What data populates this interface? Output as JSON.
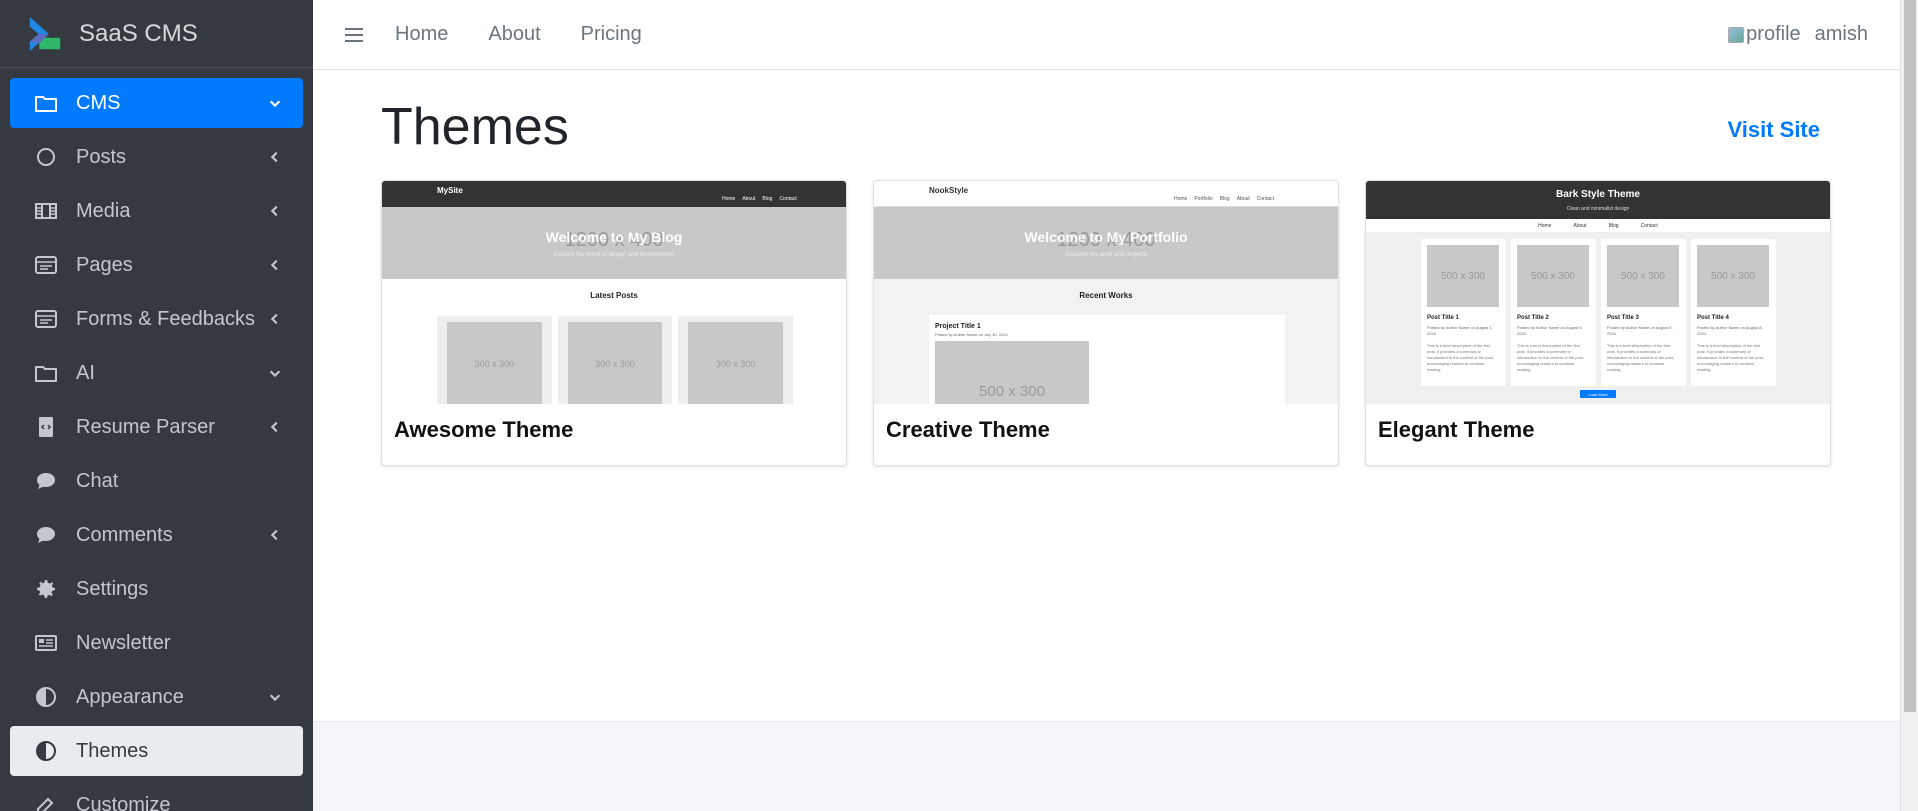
{
  "brand": {
    "name": "SaaS CMS"
  },
  "sidebar": {
    "items": [
      {
        "label": "CMS",
        "icon": "folder-icon",
        "arrow": "down",
        "state": "active"
      },
      {
        "label": "Posts",
        "icon": "circle-icon",
        "arrow": "left",
        "state": ""
      },
      {
        "label": "Media",
        "icon": "film-icon",
        "arrow": "left",
        "state": ""
      },
      {
        "label": "Pages",
        "icon": "window-icon",
        "arrow": "left",
        "state": ""
      },
      {
        "label": "Forms & Feedbacks",
        "icon": "window-icon",
        "arrow": "left",
        "state": ""
      },
      {
        "label": "AI",
        "icon": "folder-icon",
        "arrow": "down",
        "state": ""
      },
      {
        "label": "Resume Parser",
        "icon": "file-code-icon",
        "arrow": "left",
        "state": ""
      },
      {
        "label": "Chat",
        "icon": "comment-icon",
        "arrow": "",
        "state": ""
      },
      {
        "label": "Comments",
        "icon": "comment-icon",
        "arrow": "left",
        "state": ""
      },
      {
        "label": "Settings",
        "icon": "gear-icon",
        "arrow": "",
        "state": ""
      },
      {
        "label": "Newsletter",
        "icon": "newspaper-icon",
        "arrow": "",
        "state": ""
      },
      {
        "label": "Appearance",
        "icon": "half-circle-icon",
        "arrow": "down",
        "state": ""
      },
      {
        "label": "Themes",
        "icon": "half-circle-icon",
        "arrow": "",
        "state": "selected"
      },
      {
        "label": "Customize",
        "icon": "edit-icon",
        "arrow": "",
        "state": ""
      }
    ]
  },
  "topbar": {
    "links": [
      "Home",
      "About",
      "Pricing"
    ],
    "profile_alt": "profile",
    "username": "amish"
  },
  "main": {
    "title": "Themes",
    "visit_link": "Visit Site",
    "themes": [
      {
        "name": "Awesome Theme",
        "preview": {
          "site": "MySite",
          "nav": [
            "Home",
            "About",
            "Blog",
            "Contact"
          ],
          "hero_placeholder": "1200 x 400",
          "hero_title": "Welcome to My Blog",
          "hero_sub": "Explore the world of design and development",
          "section": "Latest Posts",
          "thumbs": [
            "300 x 300",
            "300 x 300",
            "300 x 300"
          ]
        }
      },
      {
        "name": "Creative Theme",
        "preview": {
          "site": "NookStyle",
          "nav": [
            "Home",
            "Portfolio",
            "Blog",
            "About",
            "Contact"
          ],
          "hero_placeholder": "1200 x 400",
          "hero_title": "Welcome to My Portfolio",
          "hero_sub": "Discover my work and projects",
          "section": "Recent Works",
          "project_title": "Project Title 1",
          "project_meta": "Posted by Author Name on July 30, 2024",
          "project_image": "500 x 300"
        }
      },
      {
        "name": "Elegant Theme",
        "preview": {
          "site": "Bark Style Theme",
          "tagline": "Clean and minimalist design",
          "nav": [
            "Home",
            "About",
            "Blog",
            "Contact"
          ],
          "posts": [
            {
              "img": "500 x 300",
              "title": "Post Title 1",
              "meta": "Posted by Author Name on August 1, 2024"
            },
            {
              "img": "500 x 300",
              "title": "Post Title 2",
              "meta": "Posted by Author Name on August 5, 2024"
            },
            {
              "img": "500 x 300",
              "title": "Post Title 3",
              "meta": "Posted by Author Name on August 5, 2024"
            },
            {
              "img": "500 x 300",
              "title": "Post Title 4",
              "meta": "Posted by Author Name on August 8, 2024"
            }
          ],
          "post_text": "This is a brief description of the first post. It provides a summary or introduction to the content of the post, encouraging readers to continue reading.",
          "button": "Load More"
        }
      }
    ]
  },
  "colors": {
    "sidebar_bg": "#343a40",
    "accent": "#007bff",
    "selected_bg": "#e9ecef"
  }
}
